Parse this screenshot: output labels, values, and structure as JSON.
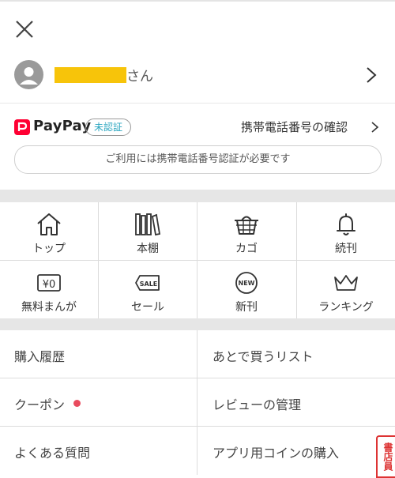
{
  "user": {
    "suffix": "さん"
  },
  "paypay": {
    "brand": "PayPay",
    "status_badge": "未認証",
    "link_label": "携帯電話番号の確認",
    "notice": "ご利用には携帯電話番号認証が必要です"
  },
  "shortcuts": [
    {
      "label": "トップ",
      "icon": "home-icon"
    },
    {
      "label": "本棚",
      "icon": "bookshelf-icon"
    },
    {
      "label": "カゴ",
      "icon": "basket-icon"
    },
    {
      "label": "続刊",
      "icon": "bell-icon"
    },
    {
      "label": "無料まんが",
      "icon": "yen-icon"
    },
    {
      "label": "セール",
      "icon": "sale-tag-icon"
    },
    {
      "label": "新刊",
      "icon": "new-badge-icon"
    },
    {
      "label": "ランキング",
      "icon": "crown-icon"
    }
  ],
  "menu": [
    {
      "label": "購入履歴"
    },
    {
      "label": "あとで買うリスト"
    },
    {
      "label": "クーポン"
    },
    {
      "label": "レビューの管理"
    },
    {
      "label": "よくある質問"
    },
    {
      "label": "アプリ用コインの購入"
    }
  ],
  "stamp": {
    "text": "書店員"
  },
  "colors": {
    "paypay_red": "#ff0033",
    "badge_text": "#2ba6c0",
    "coupon_dot": "#e94b5e",
    "name_mask": "#f7c40a"
  }
}
